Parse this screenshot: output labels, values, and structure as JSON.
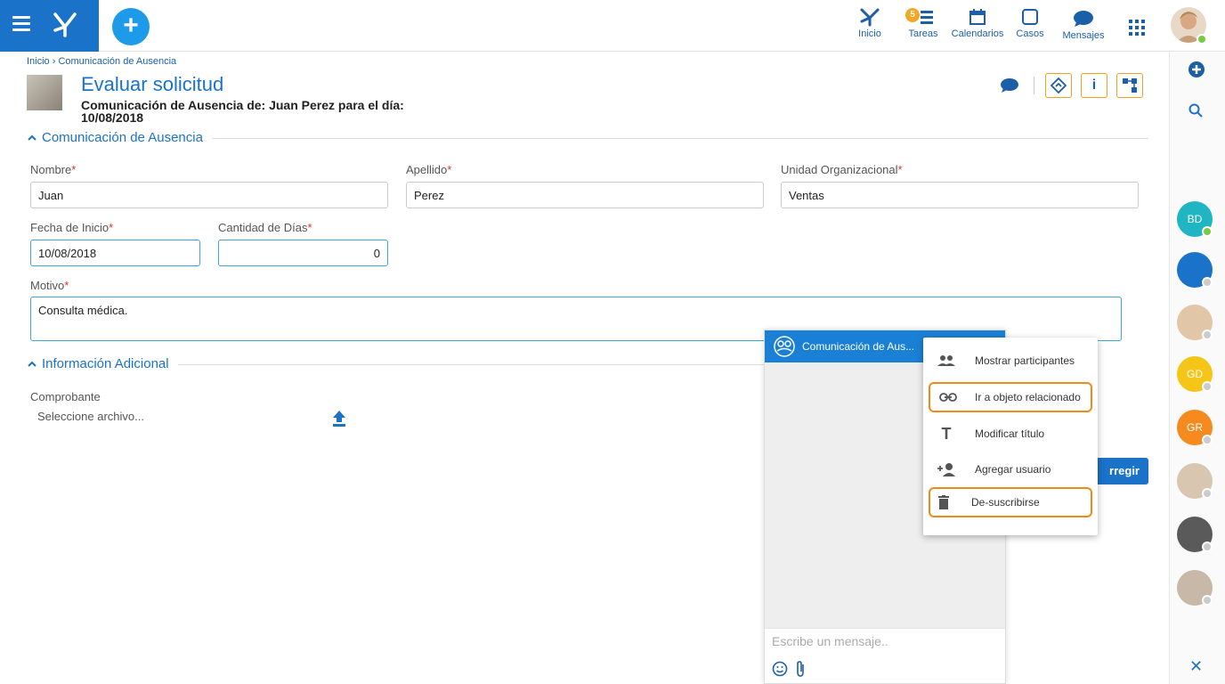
{
  "nav": {
    "items": [
      {
        "label": "Inicio",
        "icon": "process-icon"
      },
      {
        "label": "Tareas",
        "icon": "tasks-icon",
        "badge": "5"
      },
      {
        "label": "Calendarios",
        "icon": "calendar-icon"
      },
      {
        "label": "Casos",
        "icon": "case-icon"
      },
      {
        "label": "Mensajes",
        "icon": "chat-icon"
      }
    ]
  },
  "breadcrumb": "Inicio › Comunicación de Ausencia",
  "page": {
    "title": "Evaluar solicitud",
    "subtitle": "Comunicación de Ausencia de: Juan Perez para el día: 10/08/2018"
  },
  "sections": {
    "main": "Comunicación de Ausencia",
    "extra": "Información Adicional"
  },
  "form": {
    "nombre": {
      "label": "Nombre",
      "value": "Juan"
    },
    "apellido": {
      "label": "Apellido",
      "value": "Perez"
    },
    "unidad": {
      "label": "Unidad Organizacional",
      "value": "Ventas"
    },
    "fecha": {
      "label": "Fecha de Inicio",
      "value": "10/08/2018"
    },
    "dias": {
      "label": "Cantidad de Días",
      "value": "0"
    },
    "motivo": {
      "label": "Motivo",
      "value": "Consulta médica."
    },
    "comprobante": {
      "label": "Comprobante",
      "value": "Seleccione archivo..."
    }
  },
  "action_button": "rregir",
  "chat": {
    "title": "Comunicación de Aus...",
    "placeholder": "Escribe un mensaje.."
  },
  "menu": [
    {
      "label": "Mostrar participantes",
      "icon": "people-icon"
    },
    {
      "label": "Ir a objeto relacionado",
      "icon": "link-icon"
    },
    {
      "label": "Modificar título",
      "icon": "text-icon"
    },
    {
      "label": "Agregar usuario",
      "icon": "add-user-icon"
    },
    {
      "label": "De-suscribirse",
      "icon": "trash-icon"
    }
  ],
  "rail": [
    {
      "initials": "BD",
      "color": "#1fb5c2",
      "status": "#7ac943"
    },
    {
      "initials": "",
      "color": "#1a73c8",
      "status": "#cccccc"
    },
    {
      "initials": "",
      "color": "#e2c6a8",
      "status": "#cccccc"
    },
    {
      "initials": "GD",
      "color": "#f5c518",
      "status": "#cccccc"
    },
    {
      "initials": "GR",
      "color": "#f58a1f",
      "status": "#cccccc"
    },
    {
      "initials": "",
      "color": "#d8c6b0",
      "status": "#cccccc"
    },
    {
      "initials": "",
      "color": "#5a5a5a",
      "status": "#cccccc"
    },
    {
      "initials": "",
      "color": "#c8b8a8",
      "status": "#cccccc"
    }
  ],
  "colors": {
    "primary": "#1a73c8",
    "accent": "#f08a1c",
    "required": "#d9342b"
  }
}
